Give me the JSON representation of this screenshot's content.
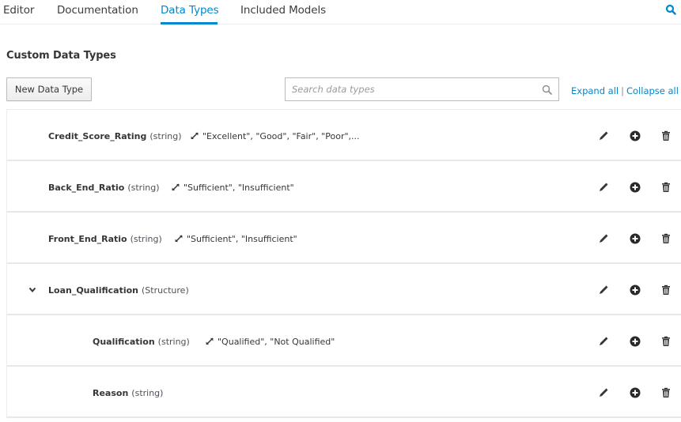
{
  "tabs": [
    {
      "label": "Editor",
      "active": false
    },
    {
      "label": "Documentation",
      "active": false
    },
    {
      "label": "Data Types",
      "active": true
    },
    {
      "label": "Included Models",
      "active": false
    }
  ],
  "top_search_icon": "search-icon",
  "section_title": "Custom Data Types",
  "toolbar": {
    "new_button_label": "New Data Type",
    "search_placeholder": "Search data types",
    "search_value": "",
    "expand_all": "Expand all",
    "separator": "|",
    "collapse_all": "Collapse all"
  },
  "colors": {
    "accent": "#0088ce",
    "text": "#363636",
    "border": "#e8e8e8"
  },
  "data_types": [
    {
      "name": "Credit_Score_Rating",
      "type": "(string)",
      "constraint": "\"Excellent\", \"Good\", \"Fair\", \"Poor\",...",
      "level": 0,
      "expandable": false
    },
    {
      "name": "Back_End_Ratio",
      "type": "(string)",
      "constraint": "\"Sufficient\", \"Insufficient\"",
      "level": 0,
      "expandable": false
    },
    {
      "name": "Front_End_Ratio",
      "type": "(string)",
      "constraint": "\"Sufficient\", \"Insufficient\"",
      "level": 0,
      "expandable": false
    },
    {
      "name": "Loan_Qualification",
      "type": "(Structure)",
      "constraint": "",
      "level": 0,
      "expandable": true,
      "expanded": true
    },
    {
      "name": "Qualification",
      "type": "(string)",
      "constraint": "\"Qualified\", \"Not Qualified\"",
      "level": 1,
      "expandable": false
    },
    {
      "name": "Reason",
      "type": "(string)",
      "constraint": "",
      "level": 1,
      "expandable": false
    }
  ],
  "row_actions": [
    {
      "name": "edit",
      "icon": "pencil-icon"
    },
    {
      "name": "add",
      "icon": "plus-circle-icon"
    },
    {
      "name": "delete",
      "icon": "trash-icon"
    }
  ]
}
